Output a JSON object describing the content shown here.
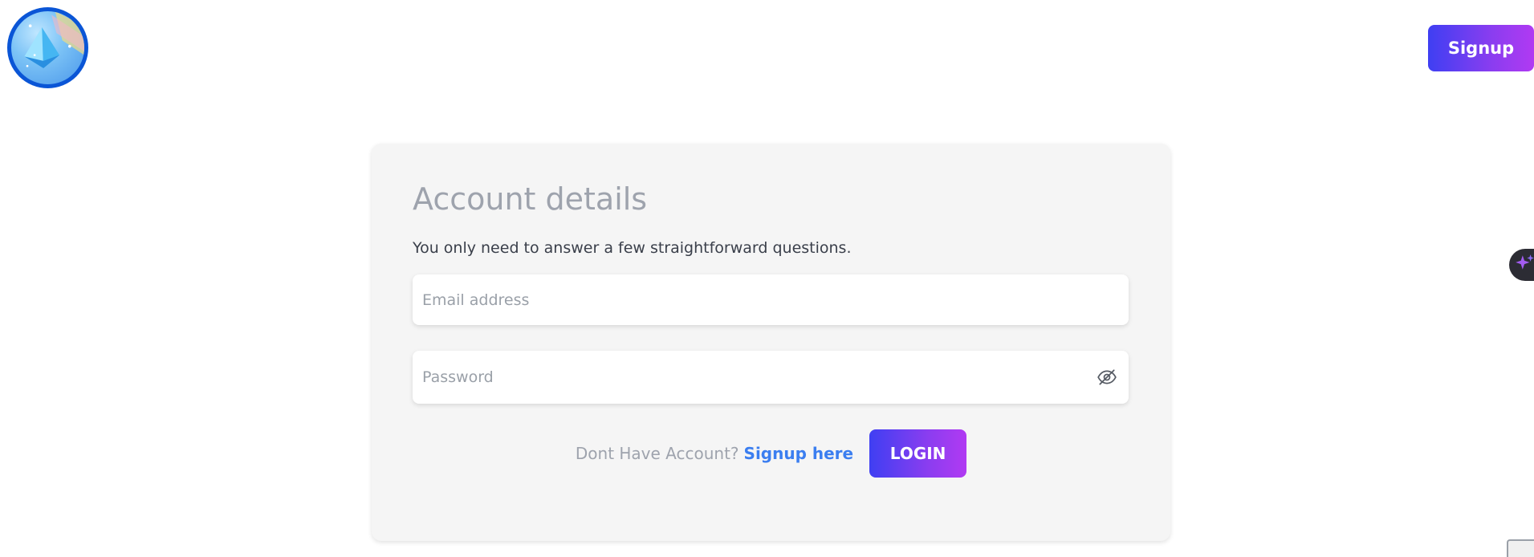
{
  "header": {
    "logo_icon": "crystal-logo-icon",
    "signup_label": "Signup"
  },
  "card": {
    "title": "Account details",
    "subtitle": "You only need to answer a few straightforward questions.",
    "email": {
      "placeholder": "Email address",
      "value": ""
    },
    "password": {
      "placeholder": "Password",
      "value": "",
      "toggle_icon": "eye-off-icon"
    },
    "prompt": "Dont Have Account?",
    "signup_link": "Signup here",
    "login_label": "LOGIN"
  },
  "side": {
    "ai_icon": "sparkle-icon"
  },
  "colors": {
    "accent_start": "#3f3ff2",
    "accent_end": "#b13af2",
    "link": "#3b7ef0",
    "card_bg": "#f5f5f5"
  }
}
